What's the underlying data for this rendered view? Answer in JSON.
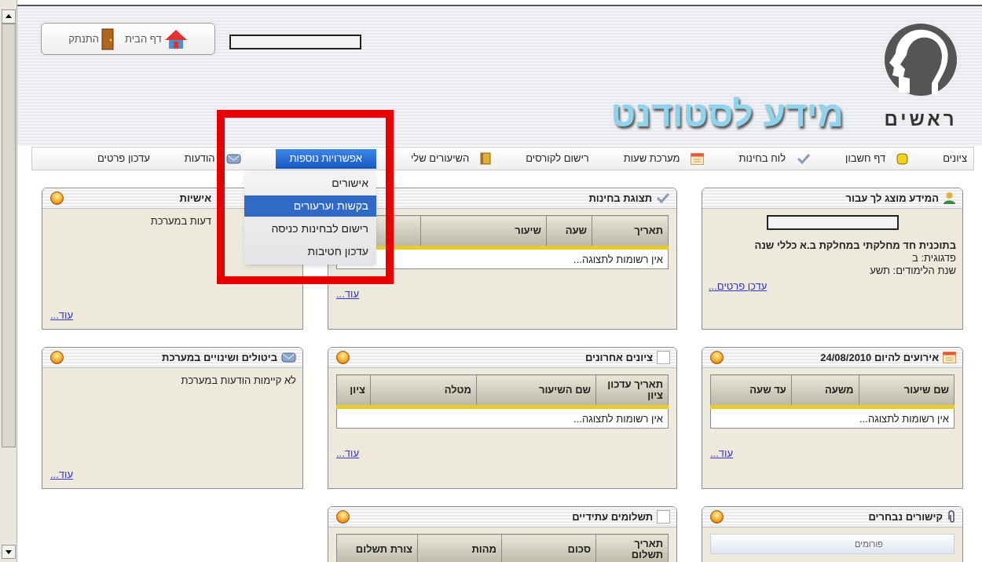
{
  "toolbar": [
    {
      "kind": "home",
      "label": "דף הבית"
    },
    {
      "kind": "logout",
      "label": "התנתק"
    }
  ],
  "brand": {
    "logo_text": "ראשים",
    "title": "מידע לסטודנט"
  },
  "nav": [
    {
      "label": "ציונים",
      "selected": false
    },
    {
      "label": "דף חשבון",
      "selected": false
    },
    {
      "label": "לוח בחינות",
      "selected": false
    },
    {
      "label": "מערכת שעות",
      "selected": false
    },
    {
      "label": "רישום לקורסים",
      "selected": false
    },
    {
      "label": "השיעורים שלי",
      "selected": false
    },
    {
      "label": "אפשרויות נוספות",
      "selected": true
    },
    {
      "label": "הודעות",
      "selected": false
    },
    {
      "label": "עדכון פרטים",
      "selected": false
    }
  ],
  "dropdown": [
    {
      "label": "אישורים",
      "selected": false
    },
    {
      "label": "בקשות וערעורים",
      "selected": true
    },
    {
      "label": "רישום לבחינות כניסה",
      "selected": false
    },
    {
      "label": "עדכון חטיבות",
      "selected": false
    }
  ],
  "columns": [
    [
      {
        "title": "המידע מוצג לך עבור",
        "collapse_button": false,
        "kind": "info",
        "lines": [
          {
            "text": "בתוכנית חד מחלקתי במחלקת ב.א כללי שנה",
            "bold": true
          },
          {
            "text": "פדגוגית: ב",
            "bold": false
          },
          {
            "text": "שנת הלימודים: תשע",
            "bold": false
          }
        ],
        "link": "עדכן פרטים..."
      },
      {
        "title": "אירועים להיום 24/08/2010",
        "collapse_button": true,
        "kind": "table",
        "columns": [
          "שם שיעור",
          "משעה",
          "עד שעה"
        ],
        "rows_message": "אין רשומות לתצוגה...",
        "link": "עוד..."
      },
      {
        "title": "קישורים נבחרים",
        "collapse_button": true,
        "kind": "links",
        "links": [
          "פורומים"
        ]
      }
    ],
    [
      {
        "title": "תצוגת בחינות",
        "collapse_button": false,
        "kind": "table",
        "columns": [
          "תאריך",
          "שעה",
          "שיעור"
        ],
        "rows_message": "אין רשומות לתצוגה...",
        "link": "עוד..."
      },
      {
        "title": "ציונים אחרונים",
        "collapse_button": true,
        "kind": "table",
        "columns": [
          "תאריך עדכון ציון",
          "שם השיעור",
          "מטלה",
          "ציון"
        ],
        "rows_message": "אין רשומות לתצוגה...",
        "link": "עוד..."
      },
      {
        "title": "תשלומים עתידיים",
        "collapse_button": true,
        "kind": "table",
        "columns": [
          "תאריך תשלום",
          "סכום",
          "מהות",
          "צורת תשלום"
        ]
      }
    ],
    [
      {
        "title": "אישיות",
        "collapse_button": true,
        "kind": "message",
        "message": "דעות במערכת",
        "link": "עוד..."
      },
      {
        "title": "ביטולים ושינויים במערכת",
        "collapse_button": true,
        "kind": "message",
        "message": "לא קיימות הודעות במערכת",
        "link": "עוד..."
      }
    ]
  ]
}
